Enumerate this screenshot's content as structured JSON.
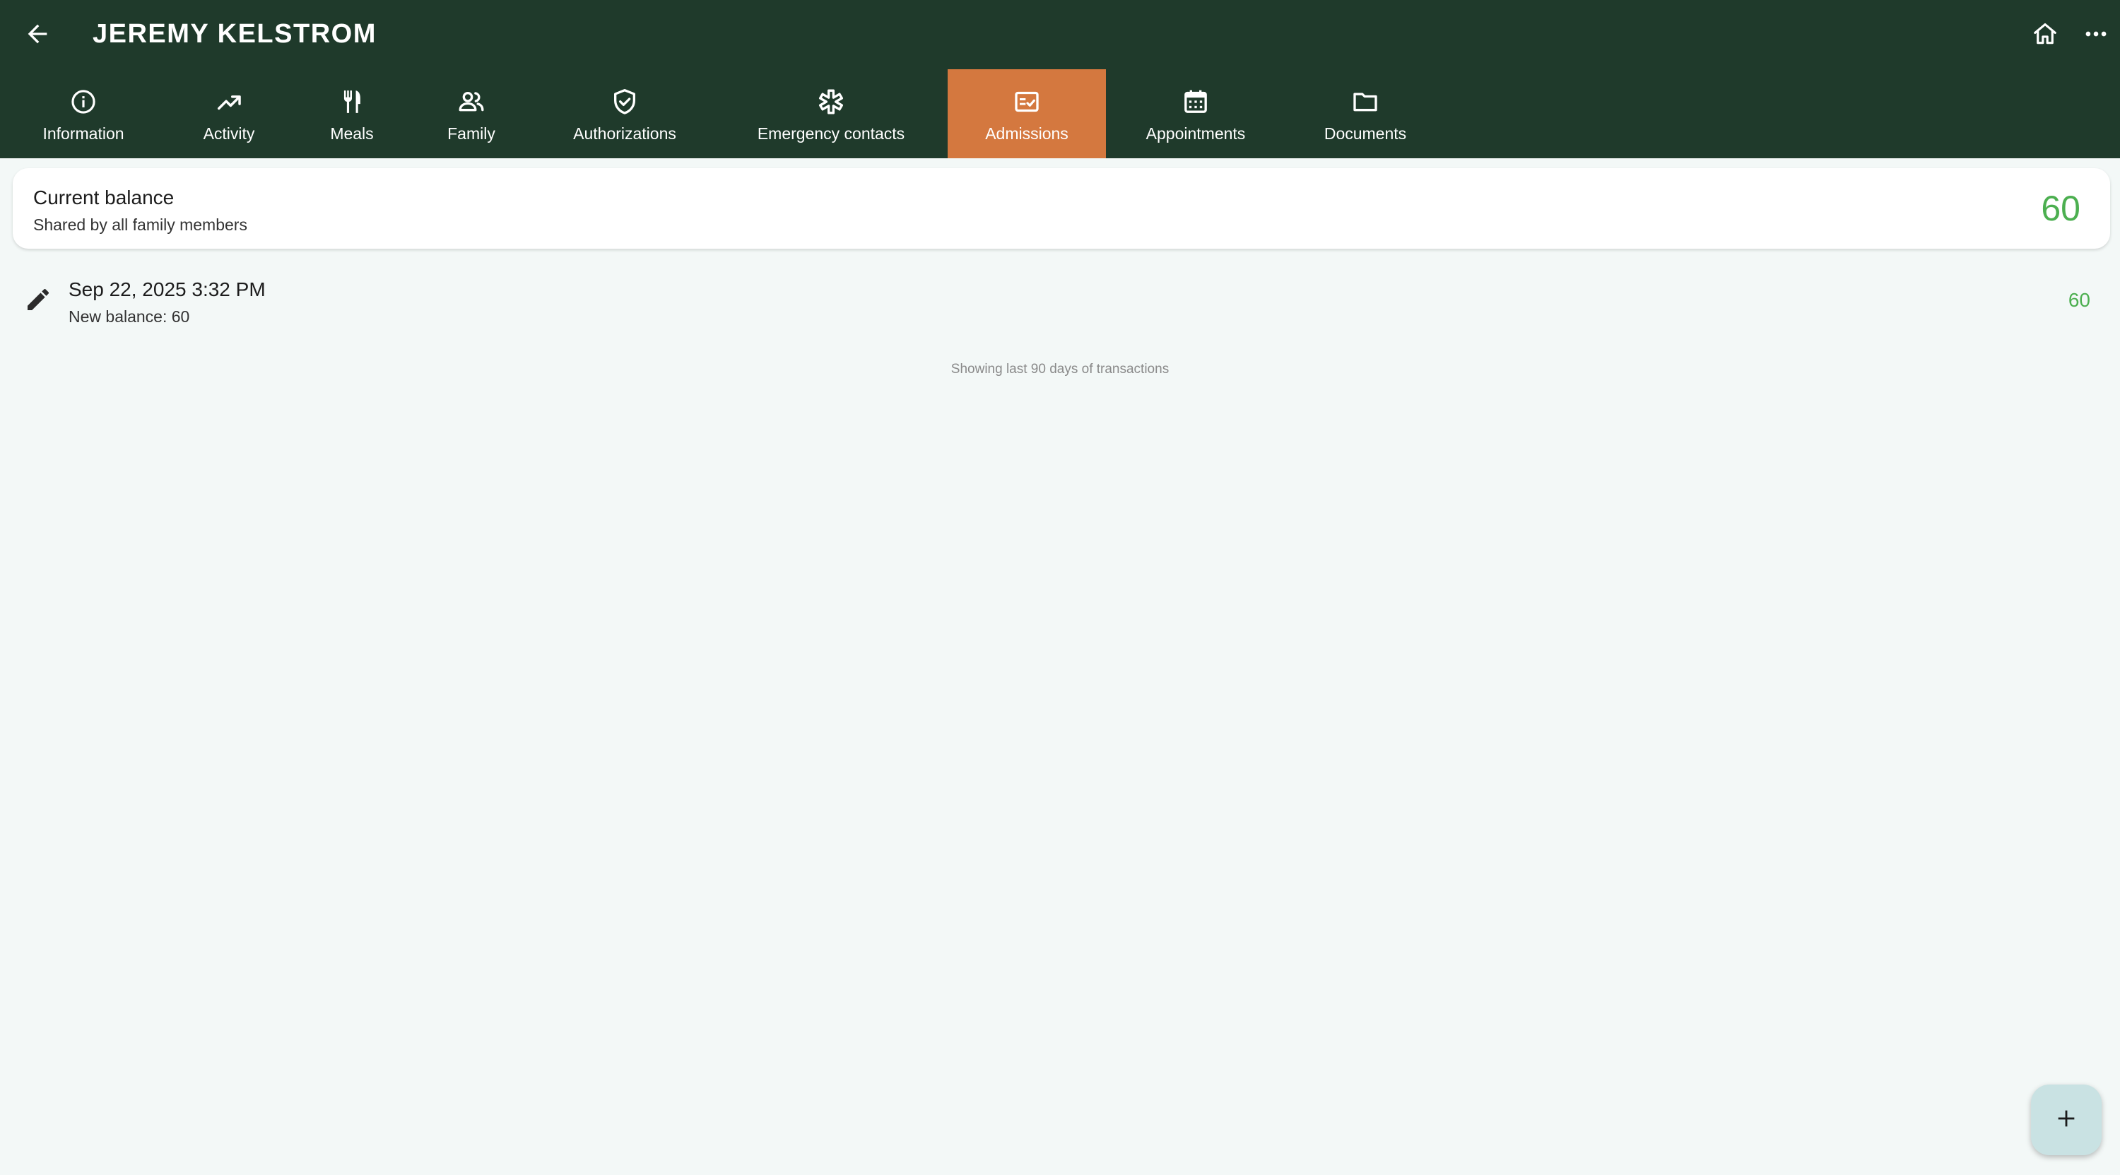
{
  "header": {
    "title": "JEREMY KELSTROM",
    "icons": {
      "back": "arrow-left-icon",
      "home": "home-icon",
      "more": "more-horizontal-icon"
    },
    "background_color": "#1f3a2b"
  },
  "tabs": [
    {
      "label": "Information",
      "icon": "info-icon",
      "active": false
    },
    {
      "label": "Activity",
      "icon": "trending-up-icon",
      "active": false
    },
    {
      "label": "Meals",
      "icon": "fork-knife-icon",
      "active": false
    },
    {
      "label": "Family",
      "icon": "people-icon",
      "active": false
    },
    {
      "label": "Authorizations",
      "icon": "shield-check-icon",
      "active": false
    },
    {
      "label": "Emergency contacts",
      "icon": "medical-star-icon",
      "active": false
    },
    {
      "label": "Admissions",
      "icon": "ticket-check-icon",
      "active": true
    },
    {
      "label": "Appointments",
      "icon": "calendar-icon",
      "active": false
    },
    {
      "label": "Documents",
      "icon": "folder-icon",
      "active": false
    }
  ],
  "active_tab_color": "#d4783f",
  "balance": {
    "title": "Current balance",
    "subtitle": "Shared by all family members",
    "value": "60",
    "value_color": "#4caf50"
  },
  "transactions": [
    {
      "date": "Sep 22, 2025 3:32 PM",
      "new_balance": "New balance: 60",
      "amount": "60",
      "icon": "pencil-icon"
    }
  ],
  "footnote": "Showing last 90 days of transactions",
  "fab": {
    "icon": "plus-icon"
  }
}
